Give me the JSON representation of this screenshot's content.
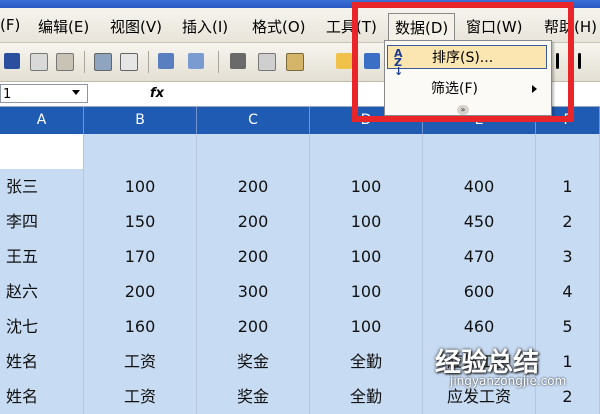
{
  "menubar": {
    "items": [
      {
        "label": "(F)"
      },
      {
        "label": "编辑(E)"
      },
      {
        "label": "视图(V)"
      },
      {
        "label": "插入(I)"
      },
      {
        "label": "格式(O)"
      },
      {
        "label": "工具(T)"
      },
      {
        "label": "数据(D)"
      },
      {
        "label": "窗口(W)"
      },
      {
        "label": "帮助(H)"
      }
    ]
  },
  "formula_bar": {
    "name_box": "1",
    "fx": "fx"
  },
  "columns": [
    "A",
    "B",
    "C",
    "D",
    "E",
    "F"
  ],
  "rows": [
    [
      "",
      "",
      "",
      "",
      "",
      ""
    ],
    [
      "张三",
      "100",
      "200",
      "100",
      "400",
      "1"
    ],
    [
      "李四",
      "150",
      "200",
      "100",
      "450",
      "2"
    ],
    [
      "王五",
      "170",
      "200",
      "100",
      "470",
      "3"
    ],
    [
      "赵六",
      "200",
      "300",
      "100",
      "600",
      "4"
    ],
    [
      "沈七",
      "160",
      "200",
      "100",
      "460",
      "5"
    ],
    [
      "姓名",
      "工资",
      "奖金",
      "全勤",
      "应发工资",
      "1"
    ],
    [
      "姓名",
      "工资",
      "奖金",
      "全勤",
      "应发工资",
      "2"
    ]
  ],
  "data_menu": {
    "items": [
      {
        "label": "排序(S)...",
        "icon": "sort-az-icon"
      },
      {
        "label": "筛选(F)",
        "icon": "",
        "submenu": true
      }
    ],
    "expand": "»"
  },
  "watermark": {
    "main": "经验总结",
    "url": "jingyanzongjie.com"
  },
  "colors": {
    "highlight_border": "#e8262a",
    "column_header": "#1f5bb3",
    "selection": "#c7dbf3"
  }
}
